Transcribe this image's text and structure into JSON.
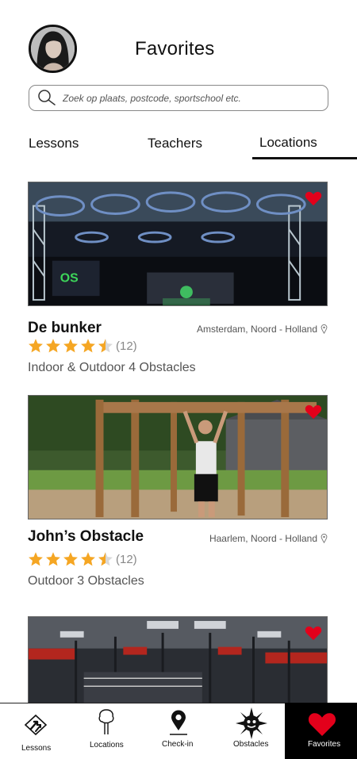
{
  "header": {
    "title": "Favorites",
    "avatar_alt": "profile photo"
  },
  "search": {
    "placeholder": "Zoek op plaats, postcode, sportschool etc.",
    "value": ""
  },
  "tabs": [
    {
      "label": "Lessons",
      "active": false
    },
    {
      "label": "Teachers",
      "active": false
    },
    {
      "label": "Locations",
      "active": true
    }
  ],
  "locations": [
    {
      "name": "De bunker",
      "place": "Amsterdam, Noord - Holland",
      "rating": 4.5,
      "rating_count": "(12)",
      "meta": "Indoor & Outdoor  4 Obstacles",
      "favorite": true
    },
    {
      "name": "John’s Obstacle",
      "place": "Haarlem, Noord - Holland",
      "rating": 4.5,
      "rating_count": "(12)",
      "meta": "Outdoor 3 Obstacles",
      "favorite": true
    },
    {
      "favorite": true
    }
  ],
  "bottom_nav": [
    {
      "label": "Lessons",
      "icon": "lessons-icon"
    },
    {
      "label": "Locations",
      "icon": "tree-icon"
    },
    {
      "label": "Check-in",
      "icon": "map-pin-icon"
    },
    {
      "label": "Obstacles",
      "icon": "spiky-ball-icon"
    },
    {
      "label": "Favorites",
      "icon": "heart-icon",
      "active": true
    }
  ],
  "colors": {
    "star": "#F5A623",
    "heart": "#E3001B",
    "active_nav_bg": "#000000"
  }
}
